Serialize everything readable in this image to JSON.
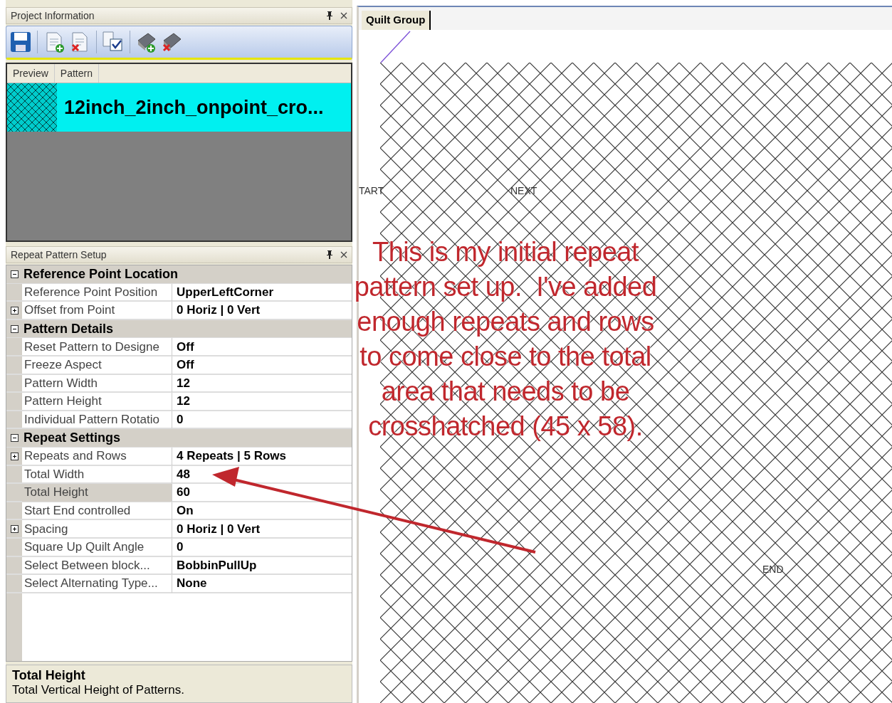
{
  "project_info": {
    "title": "Project Information",
    "columns": [
      "Preview",
      "Pattern"
    ],
    "patterns": [
      {
        "name": "12inch_2inch_onpoint_cro...",
        "selected": true
      }
    ]
  },
  "repeat_setup": {
    "title": "Repeat Pattern Setup",
    "categories": [
      {
        "label": "Reference Point Location",
        "expanded": true,
        "properties": [
          {
            "name": "Reference Point Position",
            "value": "UpperLeftCorner",
            "kind": "value",
            "selected": false
          },
          {
            "name": "Offset from Point",
            "value": "0 Horiz | 0 Vert",
            "kind": "group",
            "selected": false
          }
        ]
      },
      {
        "label": "Pattern Details",
        "expanded": true,
        "properties": [
          {
            "name": "Reset Pattern to Designe",
            "value": "Off",
            "kind": "value",
            "selected": false
          },
          {
            "name": "Freeze Aspect",
            "value": "Off",
            "kind": "value",
            "selected": false
          },
          {
            "name": "Pattern Width",
            "value": "12",
            "kind": "value",
            "selected": false
          },
          {
            "name": "Pattern Height",
            "value": "12",
            "kind": "value",
            "selected": false
          },
          {
            "name": "Individual Pattern Rotatio",
            "value": "0",
            "kind": "value",
            "selected": false
          }
        ]
      },
      {
        "label": "Repeat Settings",
        "expanded": true,
        "properties": [
          {
            "name": "Repeats and Rows",
            "value": "4 Repeats | 5 Rows",
            "kind": "group",
            "selected": false
          },
          {
            "name": "Total Width",
            "value": "48",
            "kind": "value",
            "selected": false
          },
          {
            "name": "Total Height",
            "value": "60",
            "kind": "value",
            "selected": true
          },
          {
            "name": "Start End controlled",
            "value": "On",
            "kind": "value",
            "selected": false
          },
          {
            "name": "Spacing",
            "value": "0 Horiz | 0 Vert",
            "kind": "group",
            "selected": false
          },
          {
            "name": "Square Up Quilt Angle",
            "value": "0",
            "kind": "value",
            "selected": false
          },
          {
            "name": "Select Between block...",
            "value": "BobbinPullUp",
            "kind": "value",
            "selected": false
          },
          {
            "name": "Select Alternating Type...",
            "value": "None",
            "kind": "value",
            "selected": false
          }
        ]
      }
    ],
    "description": {
      "title": "Total Height",
      "text": "Total Vertical Height of Patterns."
    }
  },
  "canvas": {
    "tab": "Quilt Group",
    "labels": [
      "TART",
      "NEXT",
      "END"
    ]
  },
  "annotation": {
    "lines": [
      "This is my initial repeat",
      "pattern set up.  I've added",
      "enough repeats and rows",
      "to come close to the total",
      "area that needs to be",
      "crosshatched (45 x 58)."
    ]
  }
}
